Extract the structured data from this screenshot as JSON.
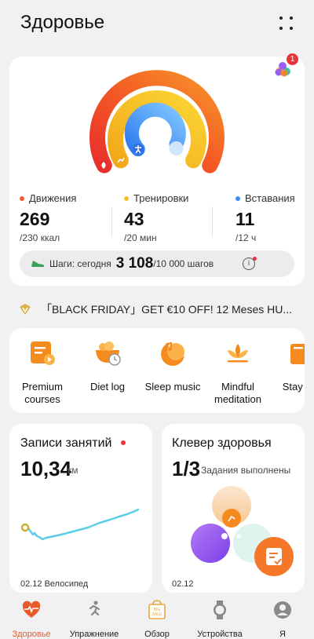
{
  "header": {
    "title": "Здоровье"
  },
  "rings": {
    "notification_count": "1",
    "colors": {
      "move": "#f05a28",
      "exercise": "#f7c12e",
      "stand": "#3d8ff5"
    }
  },
  "stats": [
    {
      "label": "Движения",
      "value": "269",
      "goal": "/230 ккал",
      "color": "#f05a28"
    },
    {
      "label": "Тренировки",
      "value": "43",
      "goal": "/20 мин",
      "color": "#f7c12e"
    },
    {
      "label": "Вставания",
      "value": "11",
      "goal": "/12 ч",
      "color": "#3d8ff5"
    }
  ],
  "steps": {
    "label": "Шаги: сегодня",
    "value": "3 108",
    "goal": "/10 000 шагов",
    "info_icon": "i"
  },
  "promo": {
    "text": "「BLACK FRIDAY」GET €10 OFF!  12 Meses HU..."
  },
  "services": [
    {
      "name": "Premium courses",
      "icon": "premium-courses-icon"
    },
    {
      "name": "Diet log",
      "icon": "diet-log-icon"
    },
    {
      "name": "Sleep music",
      "icon": "sleep-music-icon"
    },
    {
      "name": "Mindful meditation",
      "icon": "meditation-icon"
    },
    {
      "name": "Stay Fi",
      "icon": "stay-fit-icon"
    }
  ],
  "workouts": {
    "title": "Записи занятий",
    "value": "10,34",
    "unit": "км",
    "footer": "02.12  Велосипед"
  },
  "clover": {
    "title": "Клевер здоровья",
    "value": "1/3",
    "subtitle": "Задания выполнены",
    "footer": "02.12"
  },
  "nav": [
    {
      "label": "Здоровье",
      "icon": "health-icon",
      "active": true
    },
    {
      "label": "Упражнение",
      "icon": "exercise-run-icon",
      "active": false
    },
    {
      "label": "Обзор",
      "icon": "discover-icon",
      "active": false
    },
    {
      "label": "Устройства",
      "icon": "watch-icon",
      "active": false
    },
    {
      "label": "Я",
      "icon": "profile-icon",
      "active": false
    }
  ]
}
